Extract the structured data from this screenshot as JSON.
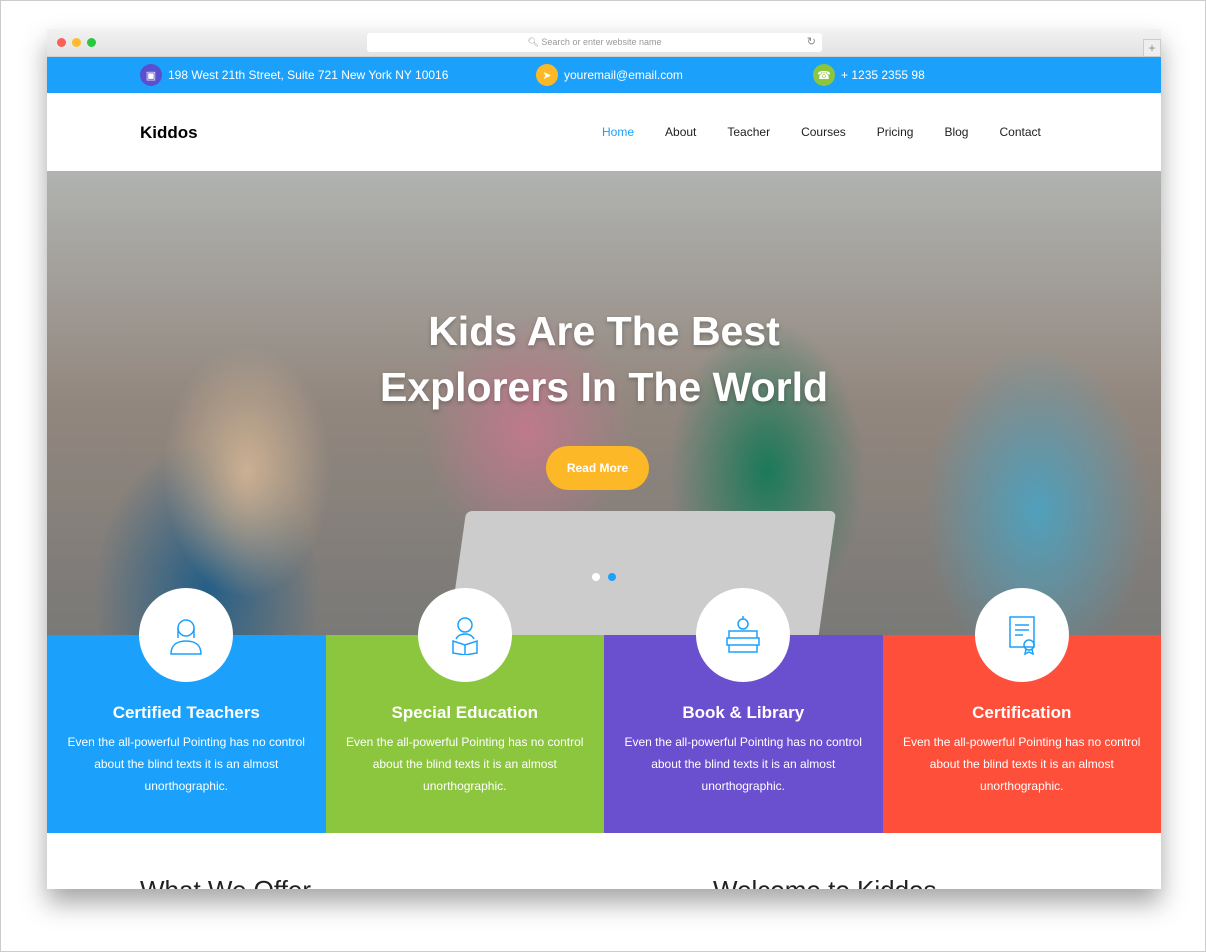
{
  "browser": {
    "url_placeholder": "Search or enter website name",
    "new_tab": "+"
  },
  "topbar": {
    "address": "198 West 21th Street, Suite 721 New York NY 10016",
    "email": "youremail@email.com",
    "phone": "+ 1235 2355 98",
    "colors": {
      "bg": "#1ba1fb",
      "address_icon": "#5a4fcf",
      "email_icon": "#fdb827",
      "phone_icon": "#8cc63f"
    }
  },
  "nav": {
    "logo": "Kiddos",
    "items": [
      {
        "label": "Home",
        "active": true
      },
      {
        "label": "About"
      },
      {
        "label": "Teacher"
      },
      {
        "label": "Courses"
      },
      {
        "label": "Pricing"
      },
      {
        "label": "Blog"
      },
      {
        "label": "Contact"
      }
    ]
  },
  "hero": {
    "title_line1": "Kids Are The Best",
    "title_line2": "Explorers In The World",
    "button": "Read More",
    "slides": 2,
    "active_slide": 2
  },
  "features": [
    {
      "title": "Certified Teachers",
      "text": "Even the all-powerful Pointing has no control about the blind texts it is an almost unorthographic.",
      "color": "#1ba1fb",
      "icon": "teacher-icon"
    },
    {
      "title": "Special Education",
      "text": "Even the all-powerful Pointing has no control about the blind texts it is an almost unorthographic.",
      "color": "#8cc63f",
      "icon": "student-reading-icon"
    },
    {
      "title": "Book & Library",
      "text": "Even the all-powerful Pointing has no control about the blind texts it is an almost unorthographic.",
      "color": "#6a4fcf",
      "icon": "books-icon"
    },
    {
      "title": "Certification",
      "text": "Even the all-powerful Pointing has no control about the blind texts it is an almost unorthographic.",
      "color": "#fe4f3a",
      "icon": "certificate-icon"
    }
  ],
  "sections": {
    "offer": "What We Offer",
    "welcome": "Welcome to Kiddos"
  }
}
